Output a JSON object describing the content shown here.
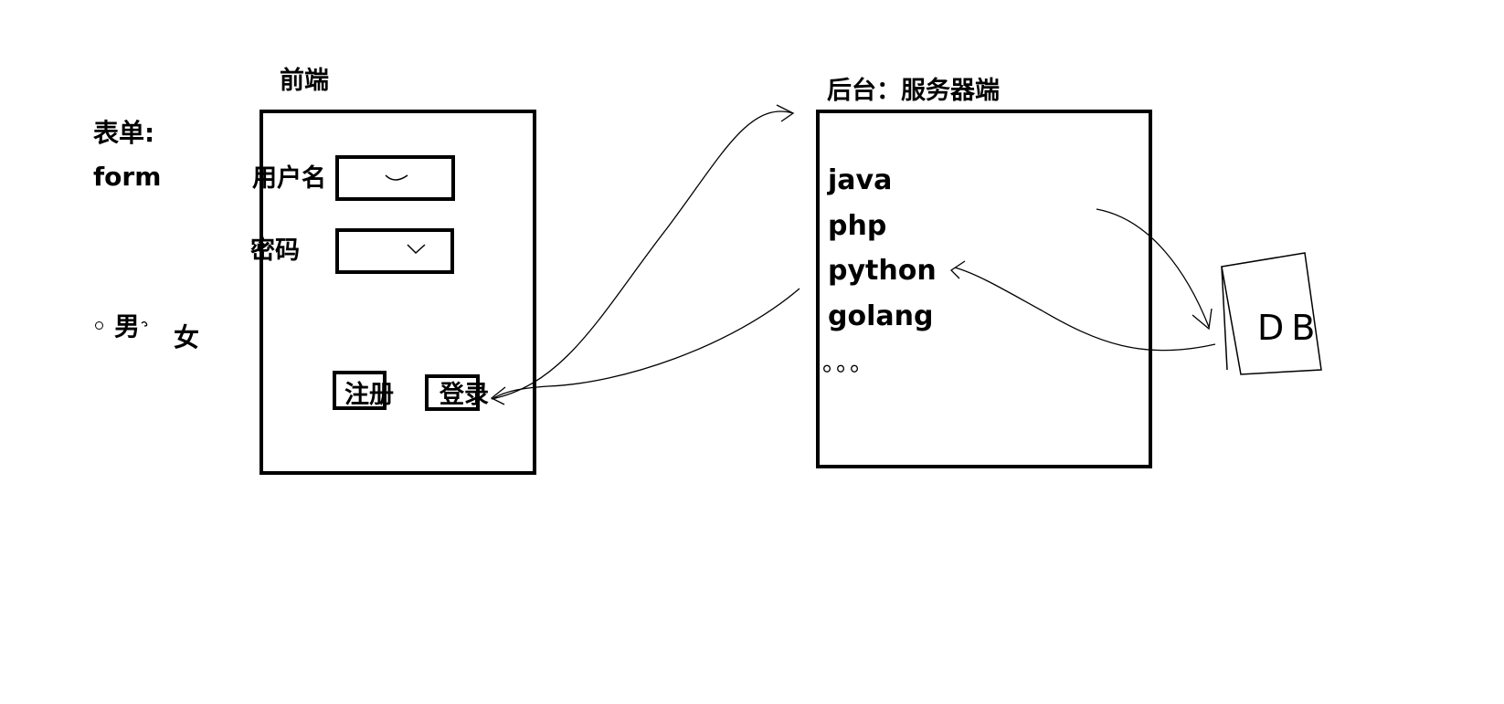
{
  "form_section": {
    "title": "表单:",
    "subtitle": "form",
    "radio_male": "男",
    "radio_female": "女"
  },
  "frontend": {
    "title": "前端",
    "username_label": "用户名",
    "password_label": "密码",
    "register_button": "注册",
    "login_button": "登录"
  },
  "backend": {
    "title": "后台：服务器端",
    "languages": [
      "java",
      "php",
      "python",
      "golang"
    ],
    "ellipsis": "。。。"
  },
  "database": {
    "label": "DB"
  },
  "colors": {
    "ink": "#000000",
    "background": "#ffffff"
  }
}
